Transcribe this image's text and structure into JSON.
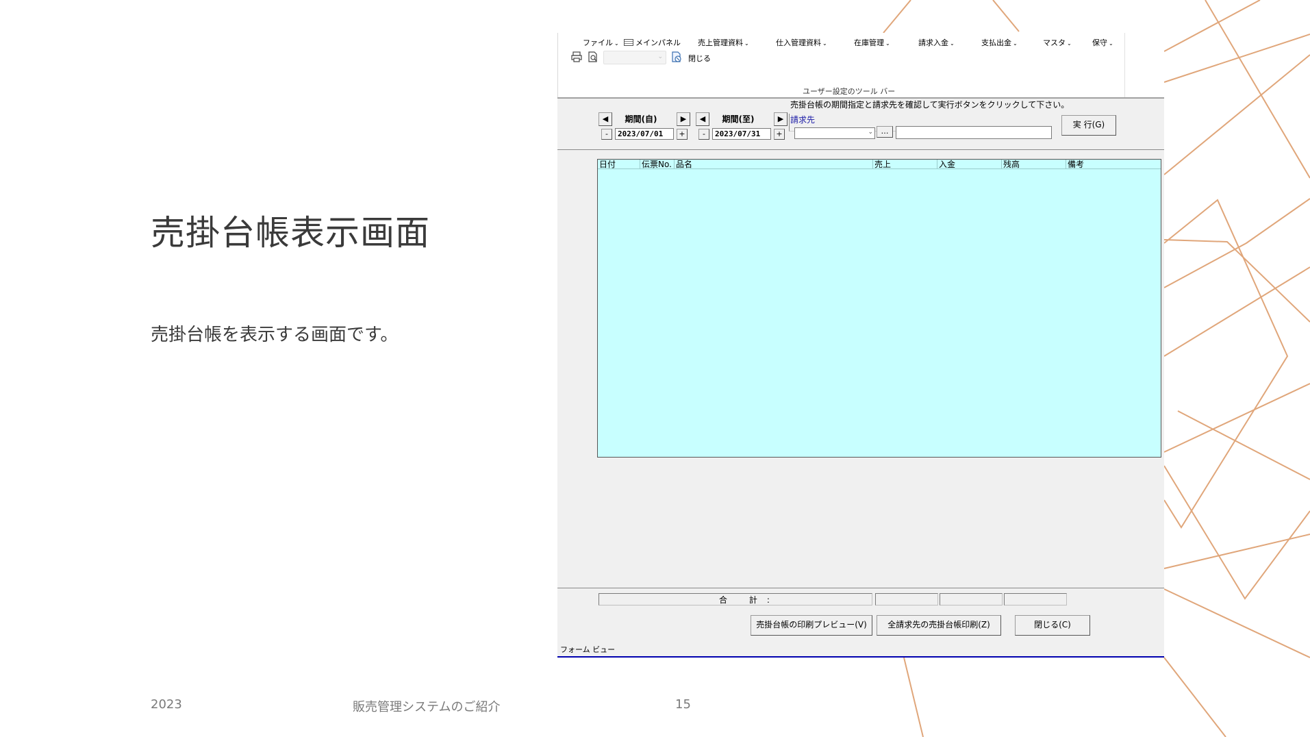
{
  "slide": {
    "title": "売掛台帳表示画面",
    "body": "売掛台帳を表示する画面です。",
    "footer_year": "2023",
    "footer_text": "販売管理システムのご紹介",
    "page_number": "15"
  },
  "colors": {
    "accent_lines": "#e0a67a",
    "grid_bg": "#c8ffff",
    "status_line": "#0000ae"
  },
  "ribbon": {
    "menus": [
      {
        "label": "ファイル",
        "icon": "chevron-down-icon"
      },
      {
        "label": "メインパネル",
        "icon": "panel-icon"
      },
      {
        "label": "売上管理資料",
        "icon": "chevron-down-icon"
      },
      {
        "label": "仕入管理資料",
        "icon": "chevron-down-icon"
      },
      {
        "label": "在庫管理",
        "icon": "chevron-down-icon"
      },
      {
        "label": "請求入金",
        "icon": "chevron-down-icon"
      },
      {
        "label": "支払出金",
        "icon": "chevron-down-icon"
      },
      {
        "label": "マスタ",
        "icon": "chevron-down-icon"
      },
      {
        "label": "保守",
        "icon": "chevron-down-icon"
      }
    ],
    "toolbar": {
      "print_icon": "printer-icon",
      "preview_icon": "print-preview-icon",
      "close_icon": "close-doc-icon",
      "close_label": "閉じる"
    },
    "group_label": "ユーザー設定のツール バー"
  },
  "form": {
    "hint": "売掛台帳の期間指定と請求先を確認して実行ボタンをクリックして下さい。",
    "period_from": {
      "label": "期間(自)",
      "value": "2023/07/01",
      "minus": "-",
      "plus": "+"
    },
    "period_to": {
      "label": "期間(至)",
      "value": "2023/07/31",
      "minus": "-",
      "plus": "+"
    },
    "customer_label": "請求先",
    "customer_value": "",
    "customer_name": "",
    "browse_label": "…",
    "run_button": "実 行(G)",
    "grid_columns": [
      "日付",
      "伝票No.",
      "品名",
      "売上",
      "入金",
      "残高",
      "備考"
    ],
    "total_label": "合 計:",
    "totals": {
      "sales": "",
      "payment": "",
      "balance": ""
    },
    "buttons": {
      "preview": "売掛台帳の印刷プレビュー(V)",
      "print_all": "全請求先の売掛台帳印刷(Z)",
      "close": "閉じる(C)"
    }
  },
  "statusbar": {
    "text": "フォーム ビュー"
  }
}
